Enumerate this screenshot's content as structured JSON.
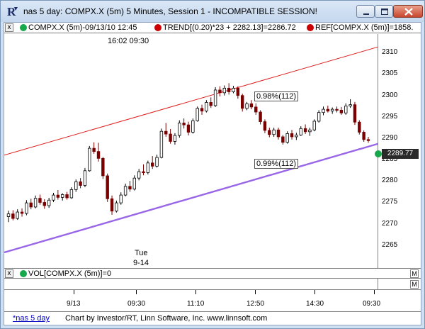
{
  "window": {
    "title": "nas 5 day:  COMPX.X (5m) 5 Minutes, Session 1 - INCOMPATIBLE SESSION!",
    "app_icon": "investor-rt-icon",
    "controls": [
      "minimize-icon",
      "maximize-icon",
      "close-icon"
    ]
  },
  "legend": {
    "close_label": "x",
    "items": [
      {
        "label": "COMPX.X (5m)-09/13/10 12:45",
        "color": "#17a84b",
        "icon": "bullet-icon"
      },
      {
        "label": "TREND[(0.20)*23 + 2282.13]=2286.72",
        "color": "#cc0000",
        "icon": "bullet-icon"
      },
      {
        "label": "REF[COMPX.X (5m)]=1858.",
        "color": "#cc0000",
        "icon": "bullet-icon"
      }
    ]
  },
  "annotations": {
    "top_time": "16:02  09:30",
    "upper_channel": "0.98%(112)",
    "lower_channel": "0.99%(112)",
    "day_label_1": "Tue",
    "day_label_2": "9-14"
  },
  "price_axis": {
    "ticks": [
      "2310",
      "2305",
      "2300",
      "2295",
      "2290",
      "2285",
      "2280",
      "2275",
      "2270",
      "2265"
    ],
    "last_price": "2289.77"
  },
  "volume_pane": {
    "close_label": "x",
    "label": "VOL[COMPX.X (5m)]=0",
    "m_label": "M"
  },
  "time_axis": {
    "ticks": [
      "9/13",
      "09:30",
      "11:10",
      "12:50",
      "14:30",
      "09:30"
    ]
  },
  "status_bar": {
    "tab": "*nas 5 day",
    "credit": "Chart by Investor/RT, Linn Software, Inc. www.linnsoft.com"
  },
  "colors": {
    "upper_channel": "#e02020",
    "lower_channel": "#9966e8",
    "bar": "#000000",
    "bar_down": "#7a0000"
  },
  "chart_data": {
    "type": "candlestick",
    "ylim": [
      2262,
      2313
    ],
    "bars": [
      [
        2273.2,
        2274.5,
        2272.0,
        2273.8
      ],
      [
        2273.8,
        2274.6,
        2272.4,
        2272.8
      ],
      [
        2272.8,
        2274.8,
        2272.5,
        2274.2
      ],
      [
        2274.2,
        2275.0,
        2273.2,
        2273.9
      ],
      [
        2273.9,
        2276.8,
        2273.5,
        2276.2
      ],
      [
        2276.2,
        2277.1,
        2274.8,
        2275.3
      ],
      [
        2275.3,
        2277.8,
        2275.0,
        2277.2
      ],
      [
        2277.2,
        2278.0,
        2275.8,
        2276.3
      ],
      [
        2276.3,
        2277.0,
        2274.9,
        2275.6
      ],
      [
        2275.6,
        2277.3,
        2275.1,
        2276.8
      ],
      [
        2276.8,
        2278.4,
        2276.4,
        2277.9
      ],
      [
        2277.9,
        2279.0,
        2276.9,
        2277.4
      ],
      [
        2277.4,
        2278.3,
        2276.7,
        2278.0
      ],
      [
        2278.0,
        2278.6,
        2276.9,
        2277.3
      ],
      [
        2277.3,
        2279.6,
        2277.1,
        2279.1
      ],
      [
        2279.1,
        2281.3,
        2278.6,
        2280.8
      ],
      [
        2280.8,
        2281.6,
        2279.4,
        2280.0
      ],
      [
        2280.0,
        2283.8,
        2279.6,
        2283.2
      ],
      [
        2283.2,
        2288.6,
        2283.0,
        2288.1
      ],
      [
        2288.1,
        2289.4,
        2286.9,
        2287.4
      ],
      [
        2287.4,
        2289.3,
        2285.2,
        2285.9
      ],
      [
        2285.9,
        2286.2,
        2281.4,
        2282.1
      ],
      [
        2282.1,
        2282.6,
        2276.4,
        2277.1
      ],
      [
        2277.1,
        2277.8,
        2273.6,
        2274.4
      ],
      [
        2274.4,
        2276.7,
        2274.1,
        2276.2
      ],
      [
        2276.2,
        2278.5,
        2275.8,
        2277.9
      ],
      [
        2277.9,
        2280.4,
        2277.6,
        2279.8
      ],
      [
        2279.8,
        2281.0,
        2278.6,
        2279.2
      ],
      [
        2279.2,
        2282.2,
        2278.9,
        2281.6
      ],
      [
        2281.6,
        2283.6,
        2281.1,
        2283.0
      ],
      [
        2283.0,
        2284.6,
        2282.2,
        2282.8
      ],
      [
        2282.8,
        2285.4,
        2282.4,
        2284.9
      ],
      [
        2284.9,
        2286.4,
        2283.6,
        2284.2
      ],
      [
        2284.2,
        2286.7,
        2283.9,
        2286.1
      ],
      [
        2286.1,
        2292.4,
        2285.9,
        2291.8
      ],
      [
        2291.8,
        2293.6,
        2290.6,
        2291.2
      ],
      [
        2291.2,
        2292.3,
        2289.1,
        2289.6
      ],
      [
        2289.6,
        2291.4,
        2288.9,
        2290.9
      ],
      [
        2290.9,
        2294.2,
        2290.4,
        2293.6
      ],
      [
        2293.6,
        2294.6,
        2292.4,
        2293.2
      ],
      [
        2293.2,
        2293.9,
        2290.9,
        2291.6
      ],
      [
        2291.6,
        2294.6,
        2291.3,
        2294.1
      ],
      [
        2294.1,
        2297.2,
        2293.9,
        2296.8
      ],
      [
        2296.8,
        2297.6,
        2295.4,
        2296.2
      ],
      [
        2296.2,
        2298.6,
        2295.9,
        2298.1
      ],
      [
        2298.1,
        2299.2,
        2296.9,
        2297.4
      ],
      [
        2297.4,
        2301.4,
        2297.1,
        2300.8
      ],
      [
        2300.8,
        2301.6,
        2299.4,
        2300.2
      ],
      [
        2300.2,
        2301.8,
        2299.6,
        2301.2
      ],
      [
        2301.2,
        2302.3,
        2299.8,
        2300.4
      ],
      [
        2300.4,
        2301.7,
        2300.1,
        2301.2
      ],
      [
        2301.2,
        2301.6,
        2298.9,
        2299.6
      ],
      [
        2299.6,
        2300.0,
        2296.1,
        2296.8
      ],
      [
        2296.8,
        2298.2,
        2296.4,
        2297.8
      ],
      [
        2297.8,
        2298.6,
        2296.6,
        2297.1
      ],
      [
        2297.1,
        2297.9,
        2295.4,
        2296.0
      ],
      [
        2296.0,
        2296.4,
        2293.3,
        2293.9
      ],
      [
        2293.9,
        2294.4,
        2291.4,
        2292.0
      ],
      [
        2292.0,
        2292.6,
        2290.5,
        2291.1
      ],
      [
        2291.1,
        2292.6,
        2290.6,
        2292.1
      ],
      [
        2292.1,
        2292.6,
        2290.0,
        2290.6
      ],
      [
        2290.6,
        2291.0,
        2288.9,
        2289.4
      ],
      [
        2289.4,
        2291.8,
        2289.1,
        2291.3
      ],
      [
        2291.3,
        2292.1,
        2290.0,
        2290.6
      ],
      [
        2290.6,
        2291.5,
        2289.9,
        2291.0
      ],
      [
        2291.0,
        2292.9,
        2290.8,
        2292.4
      ],
      [
        2292.4,
        2293.3,
        2291.2,
        2291.7
      ],
      [
        2291.7,
        2292.6,
        2290.8,
        2292.1
      ],
      [
        2292.1,
        2294.4,
        2291.8,
        2294.0
      ],
      [
        2294.0,
        2296.4,
        2293.7,
        2295.9
      ],
      [
        2295.9,
        2297.2,
        2295.3,
        2296.6
      ],
      [
        2296.6,
        2297.4,
        2295.9,
        2296.2
      ],
      [
        2296.2,
        2297.0,
        2295.6,
        2296.6
      ],
      [
        2296.6,
        2297.2,
        2295.9,
        2296.4
      ],
      [
        2296.4,
        2297.1,
        2295.4,
        2295.8
      ],
      [
        2295.8,
        2297.9,
        2295.4,
        2297.3
      ],
      [
        2297.3,
        2298.8,
        2296.9,
        2297.6
      ],
      [
        2297.6,
        2298.2,
        2293.2,
        2293.8
      ],
      [
        2293.8,
        2294.2,
        2291.1,
        2291.6
      ],
      [
        2291.6,
        2292.0,
        2289.5,
        2290.0
      ],
      [
        2290.0,
        2290.6,
        2289.3,
        2289.8
      ]
    ],
    "upper_channel": {
      "start": 2286.6,
      "end": 2310.2
    },
    "lower_channel": {
      "start": 2265.4,
      "end": 2289.1
    }
  }
}
